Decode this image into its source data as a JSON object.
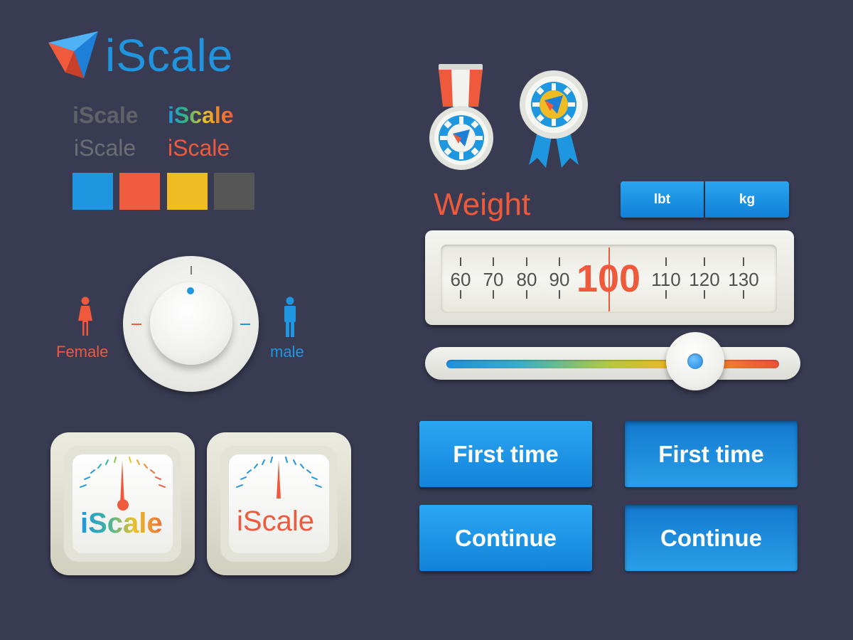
{
  "brand": {
    "logo_text": "iScale",
    "wordmarks": {
      "bold_gray": "iScale",
      "bold_gradient": "iScale",
      "thin_gray": "iScale",
      "thin_red": "iScale"
    },
    "swatches": [
      "#1f96e0",
      "#ef5c3e",
      "#f0bc24",
      "#565656"
    ]
  },
  "gender": {
    "female_label": "Female",
    "male_label": "male"
  },
  "tiles": {
    "color_word": "iScale",
    "red_word": "iScale"
  },
  "weight": {
    "title": "Weight",
    "units": [
      "lbt",
      "kg"
    ],
    "ruler_values": [
      "60",
      "70",
      "80",
      "90",
      "110",
      "120",
      "130"
    ],
    "current_value": "100",
    "slider_level": 0.66
  },
  "buttons": {
    "first_time": "First time",
    "first_time_pressed": "First time",
    "continue": "Continue",
    "continue_pressed": "Continue"
  },
  "colors": {
    "background": "#383b52",
    "blue": "#1f96e0",
    "red": "#ef5a3c",
    "yellow": "#f0bc24",
    "gray": "#565656"
  },
  "icons": [
    "iscale-logo-icon",
    "medal-icon",
    "award-ribbon-icon",
    "female-icon",
    "male-icon"
  ]
}
